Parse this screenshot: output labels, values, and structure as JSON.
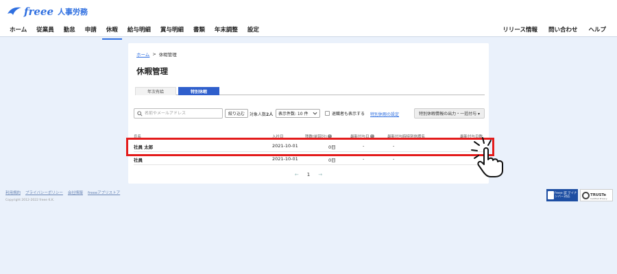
{
  "header": {
    "logo_text": "freee",
    "product_name": "人事労務",
    "nav": [
      "ホーム",
      "従業員",
      "勤怠",
      "申請",
      "休暇",
      "給与明細",
      "賞与明細",
      "書類",
      "年末調整",
      "設定"
    ],
    "active_nav": "休暇",
    "nav_right": [
      "リリース情報",
      "問い合わせ",
      "ヘルプ"
    ]
  },
  "breadcrumb": {
    "home": "ホーム",
    "separator": ">",
    "current": "休暇管理"
  },
  "page_title": "休暇管理",
  "tabs": [
    "年次有給",
    "特別休暇"
  ],
  "active_tab": "特別休暇",
  "toolbar": {
    "search_placeholder": "名前やメールアドレス",
    "filter_button": "絞り込む",
    "count_label": "対象人数",
    "count_value": "2人",
    "per_page": "表示件数: 10 件",
    "show_retired": "退職者も表示する",
    "special_settings_link": "特別休暇の設定",
    "export_button": "特別休暇情報の出力・一括付与 ▾"
  },
  "table": {
    "headers": {
      "name": "氏名",
      "join_date": "入社日",
      "remaining": "残数(前回分)",
      "last_grant_date": "最新付与日",
      "grant_reason": "最新付与時特別休暇名",
      "grant_days": "最新付与日数"
    },
    "rows": [
      {
        "name": "社員 太郎",
        "join_date": "2021-10-01",
        "remaining": "0日",
        "last_grant": "-",
        "grant_reason": "-",
        "grant_days": ""
      },
      {
        "name": "社員",
        "join_date": "2021-10-01",
        "remaining": "0日",
        "last_grant": "-",
        "grant_reason": "-",
        "grant_days": ""
      }
    ]
  },
  "pager": {
    "prev": "←",
    "page": "1",
    "next": "→"
  },
  "footer": {
    "links": [
      "利用規約",
      "プライバシーポリシー",
      "会社情報",
      "freeeアプリストア"
    ],
    "copyright": "Copyright 2012-2022 freee K.K.",
    "badge_mynumber": "freee 認 マイナンバー対応",
    "badge_truste": "TRUSTe",
    "badge_truste_sub": "Certified Privacy"
  },
  "colors": {
    "brand": "#2f6fe0",
    "highlight": "#e31b1b",
    "background": "#eaf1fb"
  }
}
